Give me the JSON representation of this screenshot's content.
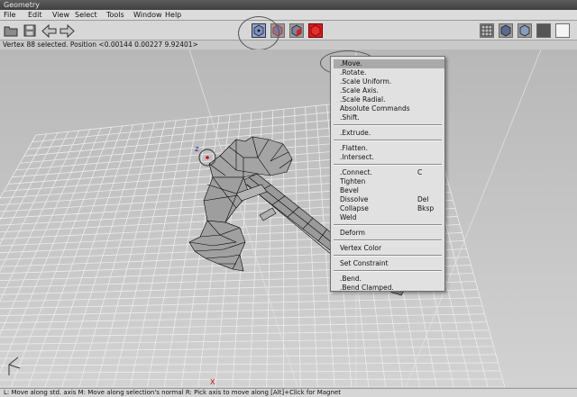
{
  "window": {
    "title": "Geometry"
  },
  "menubar": [
    "File",
    "Edit",
    "View",
    "Select",
    "Tools",
    "Window",
    "Help"
  ],
  "toolbar": {
    "left_icons": [
      "open-folder-icon",
      "save-disk-icon",
      "arrow-left-icon",
      "arrow-right-icon"
    ],
    "mode_icons": [
      "vertex-mode-icon",
      "edge-mode-icon",
      "face-mode-icon",
      "body-mode-icon"
    ],
    "right_icons": [
      "wireframe-grid-icon",
      "cube-shaded-icon",
      "cube-flat-icon",
      "dark-square-icon",
      "white-square-icon"
    ],
    "selected_mode": "vertex-mode-icon"
  },
  "info": {
    "text": "Vertex 88 selected. Position <0.00144  0.00227  9.92401>"
  },
  "viewport": {
    "axis_z": "Z",
    "axis_x": "X"
  },
  "context_menu": {
    "groups": [
      [
        {
          "label": ".Move.",
          "highlighted": true
        },
        {
          "label": ".Rotate."
        },
        {
          "label": ".Scale Uniform."
        },
        {
          "label": ".Scale Axis."
        },
        {
          "label": ".Scale Radial."
        },
        {
          "label": "Absolute Commands"
        },
        {
          "label": ".Shift."
        }
      ],
      [
        {
          "label": ".Extrude."
        }
      ],
      [
        {
          "label": ".Flatten."
        },
        {
          "label": ".Intersect."
        }
      ],
      [
        {
          "label": ".Connect.",
          "shortcut": "C"
        },
        {
          "label": "Tighten"
        },
        {
          "label": "Bevel"
        },
        {
          "label": "Dissolve",
          "shortcut": "Del"
        },
        {
          "label": "Collapse",
          "shortcut": "Bksp"
        },
        {
          "label": "Weld"
        }
      ],
      [
        {
          "label": "Deform"
        }
      ],
      [
        {
          "label": "Vertex Color"
        }
      ],
      [
        {
          "label": "Set Constraint"
        }
      ],
      [
        {
          "label": ".Bend."
        },
        {
          "label": ".Bend Clamped."
        }
      ]
    ]
  },
  "status": {
    "text": "L: Move along std. axis   M: Move along selection's normal   R: Pick axis to move along   [Alt]+Click for Magnet"
  },
  "colors": {
    "face_mode": "#d62020",
    "highlight": "#a9a9a9",
    "menu_bg": "#e1e1e1"
  }
}
